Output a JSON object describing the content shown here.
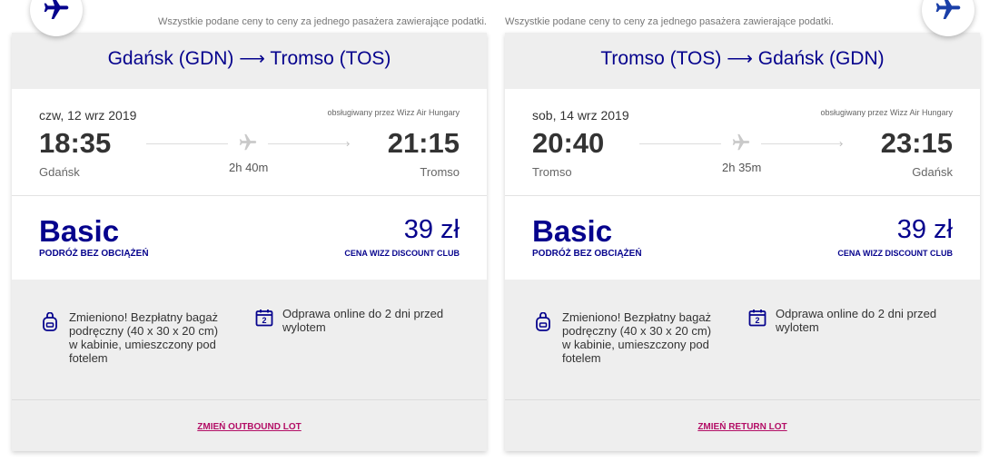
{
  "disclaimer": "Wszystkie podane ceny to ceny za jednego pasażera zawierające podatki.",
  "colors": {
    "brand": "#06038D",
    "link": "#b30e66"
  },
  "outbound": {
    "origin": "Gdańsk (GDN)",
    "arrow": "⟶",
    "destination": "Tromso (TOS)",
    "date": "czw, 12 wrz 2019",
    "operator": "obsługiwany przez Wizz Air Hungary",
    "dep_time": "18:35",
    "arr_time": "21:15",
    "dep_city": "Gdańsk",
    "arr_city": "Tromso",
    "duration": "2h 40m",
    "fare_name": "Basic",
    "fare_subtitle": "PODRÓŻ BEZ OBCIĄŻEŃ",
    "price": "39 zł",
    "price_note": "CENA WIZZ DISCOUNT CLUB",
    "feature_baggage": "Zmieniono! Bezpłatny bagaż podręczny (40 x 30 x 20 cm) w kabinie, umieszczony pod fotelem",
    "feature_checkin": "Odprawa online do 2 dni przed wylotem",
    "calendar_num": "2",
    "change_link": "ZMIEŃ OUTBOUND LOT"
  },
  "return": {
    "origin": "Tromso (TOS)",
    "arrow": "⟶",
    "destination": "Gdańsk (GDN)",
    "date": "sob, 14 wrz 2019",
    "operator": "obsługiwany przez Wizz Air Hungary",
    "dep_time": "20:40",
    "arr_time": "23:15",
    "dep_city": "Tromso",
    "arr_city": "Gdańsk",
    "duration": "2h 35m",
    "fare_name": "Basic",
    "fare_subtitle": "PODRÓŻ BEZ OBCIĄŻEŃ",
    "price": "39 zł",
    "price_note": "CENA WIZZ DISCOUNT CLUB",
    "feature_baggage": "Zmieniono! Bezpłatny bagaż podręczny (40 x 30 x 20 cm) w kabinie, umieszczony pod fotelem",
    "feature_checkin": "Odprawa online do 2 dni przed wylotem",
    "calendar_num": "2",
    "change_link": "ZMIEŃ RETURN LOT"
  },
  "icons": {
    "flight_badge": "airplane-icon",
    "duration": "airplane-icon",
    "baggage": "backpack-icon",
    "checkin": "calendar-icon"
  }
}
